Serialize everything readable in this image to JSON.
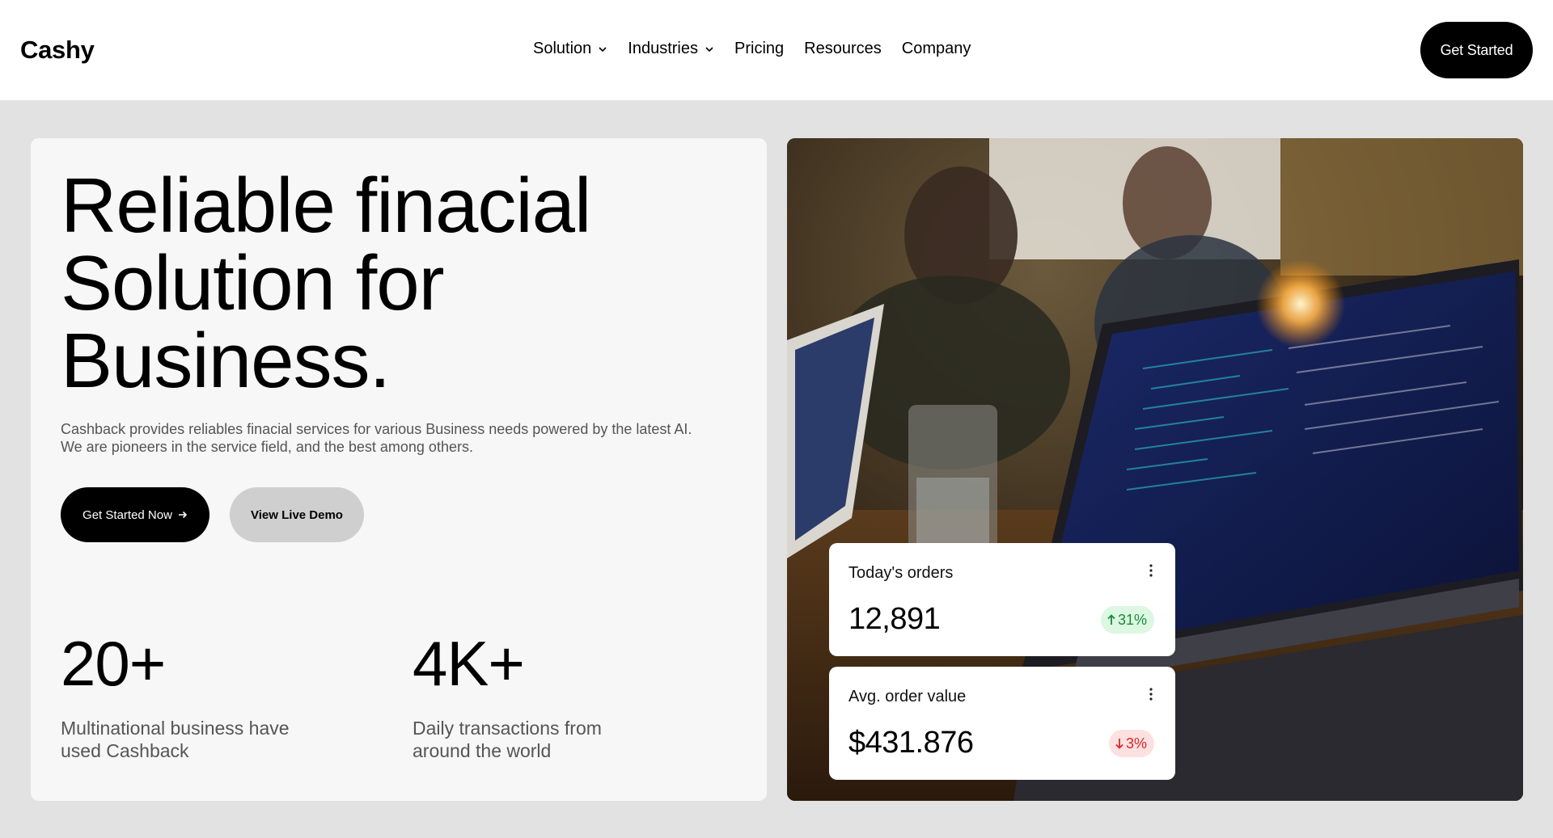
{
  "header": {
    "logo": "Cashy",
    "nav": [
      {
        "label": "Solution",
        "has_dropdown": true
      },
      {
        "label": "Industries",
        "has_dropdown": true
      },
      {
        "label": "Pricing",
        "has_dropdown": false
      },
      {
        "label": "Resources",
        "has_dropdown": false
      },
      {
        "label": "Company",
        "has_dropdown": false
      }
    ],
    "cta_label": "Get Started"
  },
  "hero": {
    "title_lines": [
      "Reliable finacial",
      "Solution for",
      "Business."
    ],
    "description_lines": [
      "Cashback provides reliables finacial services for various Business needs powered by the latest AI.",
      "We are pioneers in the service field, and the best among others."
    ],
    "primary_button": "Get Started Now",
    "primary_button_icon": "arrow-right-icon",
    "secondary_button": "View Live Demo"
  },
  "stats": [
    {
      "value": "20+",
      "label_lines": [
        "Multinational business have",
        "used Cashback"
      ]
    },
    {
      "value": "4K+",
      "label_lines": [
        "Daily transactions from",
        "around the world"
      ]
    }
  ],
  "metrics": [
    {
      "title": "Today's orders",
      "value": "12,891",
      "change": "31%",
      "direction": "up",
      "menu_icon": "more-vertical-icon"
    },
    {
      "title": "Avg. order value",
      "value": "$431.876",
      "change": "3%",
      "direction": "down",
      "menu_icon": "more-vertical-icon"
    }
  ],
  "colors": {
    "header_bg": "#ffffff",
    "page_bg": "#e2e2e2",
    "card_bg": "#f7f7f7",
    "primary": "#000000",
    "secondary_button": "#cfcfcf",
    "positive": "#1f8a3b",
    "positive_bg": "#dcf7e2",
    "negative": "#d42a2a",
    "negative_bg": "#fde0e0"
  }
}
